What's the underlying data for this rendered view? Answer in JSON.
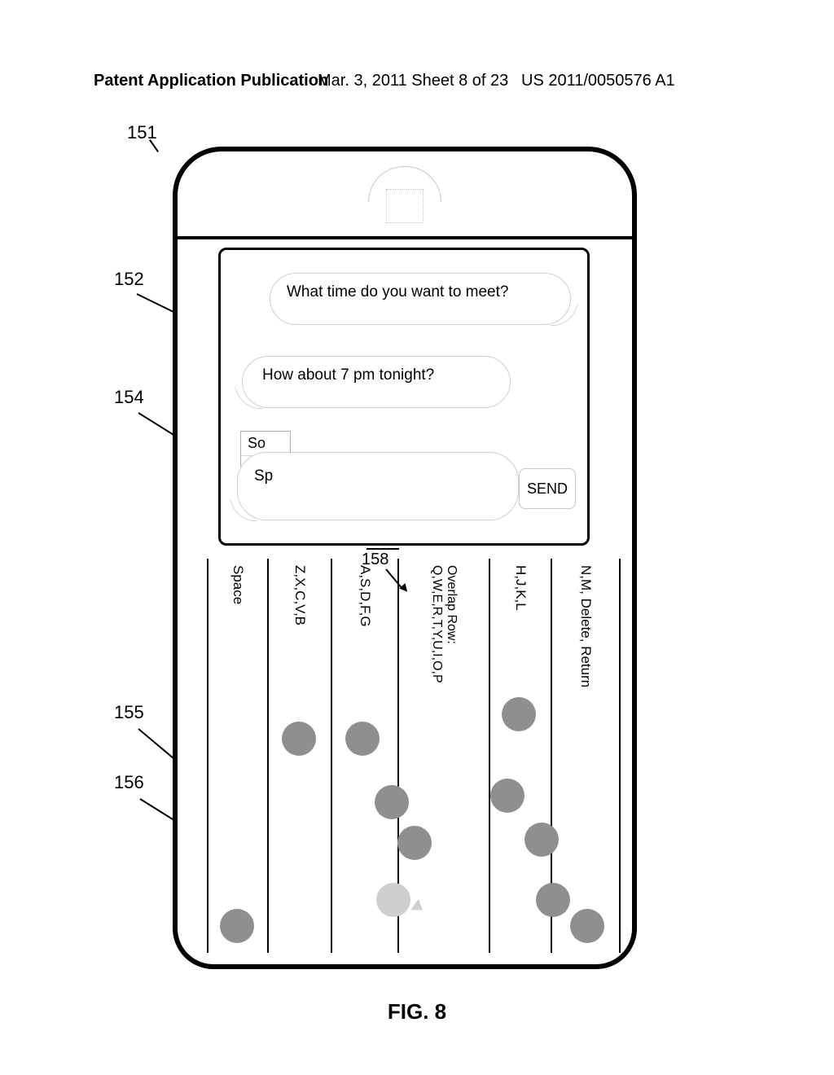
{
  "header": {
    "left": "Patent Application Publication",
    "mid": "Mar. 3, 2011  Sheet 8 of 23",
    "right": "US 2011/0050576 A1"
  },
  "refs": {
    "r151": "151",
    "r152": "152",
    "r154": "154",
    "r155": "155",
    "r156": "156",
    "r158": "158"
  },
  "chat": {
    "msg1": "What time do you want to meet?",
    "msg2": "How about 7 pm tonight?",
    "draft": "Sp",
    "popup": [
      "So",
      "Sp"
    ],
    "send": "SEND"
  },
  "keyboard": {
    "cols": [
      "Space",
      "Z,X,C,V,B",
      "A,S,D,F,G",
      "Overlap Row:\nQ,W,E,R,T,Y,U,I,O,P",
      "H,J,K,L",
      "N,M, Delete, Return"
    ],
    "ref158_label": "158"
  },
  "figure": "FIG. 8"
}
